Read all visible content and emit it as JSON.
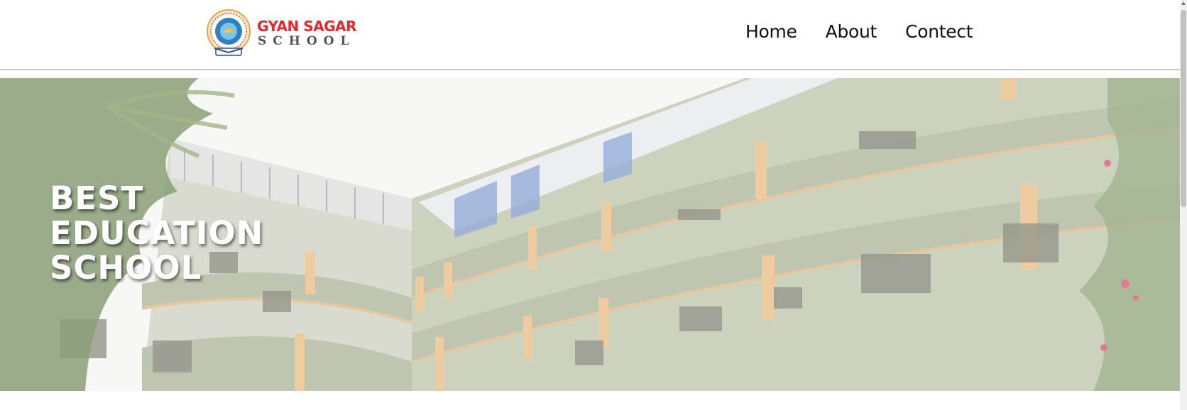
{
  "brand": {
    "name_line1": "GYAN SAGAR",
    "name_line2": "SCHOOL",
    "emblem_icon": "school-emblem-icon"
  },
  "nav": {
    "items": [
      {
        "label": "Home"
      },
      {
        "label": "About"
      },
      {
        "label": "Contect"
      }
    ]
  },
  "hero": {
    "title_lines": [
      "BEST",
      "EDUCATION",
      "SCHOOL"
    ]
  },
  "colors": {
    "brand_red": "#e8272c",
    "brand_gray": "#555555",
    "nav_text": "#111111",
    "hero_text": "#ffffff"
  }
}
